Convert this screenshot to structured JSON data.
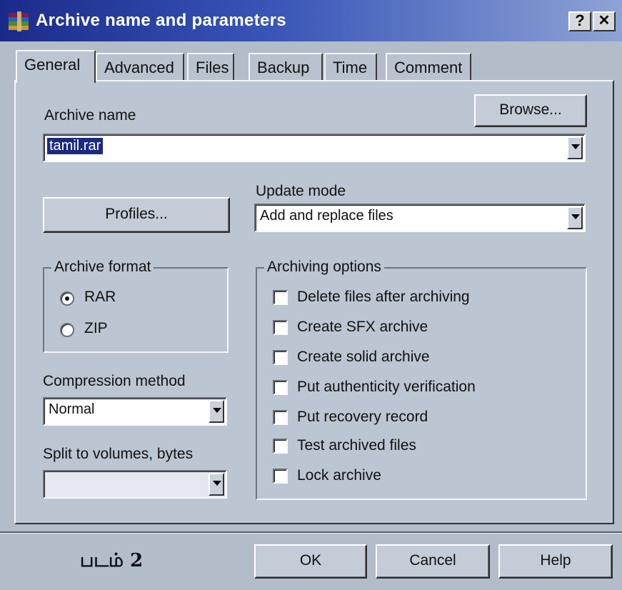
{
  "window": {
    "title": "Archive name and parameters",
    "help_label": "?",
    "close_label": "✕"
  },
  "tabs": [
    {
      "label": "General",
      "active": true
    },
    {
      "label": "Advanced",
      "active": false
    },
    {
      "label": "Files",
      "active": false
    },
    {
      "label": "Backup",
      "active": false
    },
    {
      "label": "Time",
      "active": false
    },
    {
      "label": "Comment",
      "active": false
    }
  ],
  "archive_name": {
    "label": "Archive name",
    "value": "tamil.rar",
    "browse_label": "Browse..."
  },
  "profiles_label": "Profiles...",
  "update_mode": {
    "label": "Update mode",
    "value": "Add and replace files"
  },
  "archive_format": {
    "title": "Archive format",
    "options": [
      {
        "label": "RAR",
        "selected": true
      },
      {
        "label": "ZIP",
        "selected": false
      }
    ]
  },
  "compression": {
    "label": "Compression method",
    "value": "Normal"
  },
  "split": {
    "label": "Split to volumes, bytes",
    "value": ""
  },
  "archiving_options": {
    "title": "Archiving options",
    "items": [
      {
        "label": "Delete files after archiving",
        "checked": false
      },
      {
        "label": "Create SFX archive",
        "checked": false
      },
      {
        "label": "Create solid archive",
        "checked": false
      },
      {
        "label": "Put authenticity verification",
        "checked": false
      },
      {
        "label": "Put recovery record",
        "checked": false
      },
      {
        "label": "Test archived files",
        "checked": false
      },
      {
        "label": "Lock archive",
        "checked": false
      }
    ]
  },
  "buttons": {
    "ok": "OK",
    "cancel": "Cancel",
    "help": "Help"
  },
  "caption": "படம் 2",
  "colors": {
    "title_start": "#1a2a8a",
    "title_end": "#8ea3d6",
    "panel": "#bcc6d2"
  }
}
